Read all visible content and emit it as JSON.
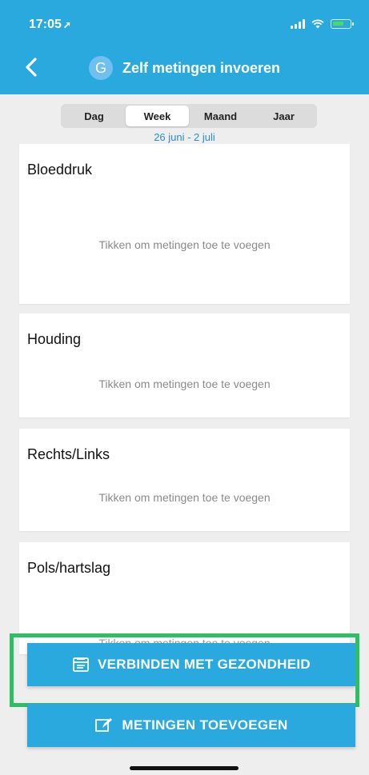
{
  "status": {
    "time": "17:05",
    "location_icon": "location-arrow-icon"
  },
  "nav": {
    "avatar_letter": "G",
    "title": "Zelf metingen invoeren"
  },
  "segments": {
    "day": "Dag",
    "week": "Week",
    "month": "Maand",
    "year": "Jaar",
    "selected": "Week"
  },
  "date_range": "26 juni - 2 juli",
  "cards": [
    {
      "title": "Bloeddruk",
      "hint": "Tikken om metingen toe te voegen"
    },
    {
      "title": "Houding",
      "hint": "Tikken om metingen toe te voegen"
    },
    {
      "title": "Rechts/Links",
      "hint": "Tikken om metingen toe te voegen"
    },
    {
      "title": "Pols/hartslag",
      "hint": "Tikken om metingen toe te voegen"
    }
  ],
  "buttons": {
    "connect_health": "VERBINDEN MET GEZONDHEID",
    "add_measurements": "METINGEN TOEVOEGEN"
  },
  "colors": {
    "primary": "#29a9dd",
    "highlight": "#2dbe66"
  }
}
